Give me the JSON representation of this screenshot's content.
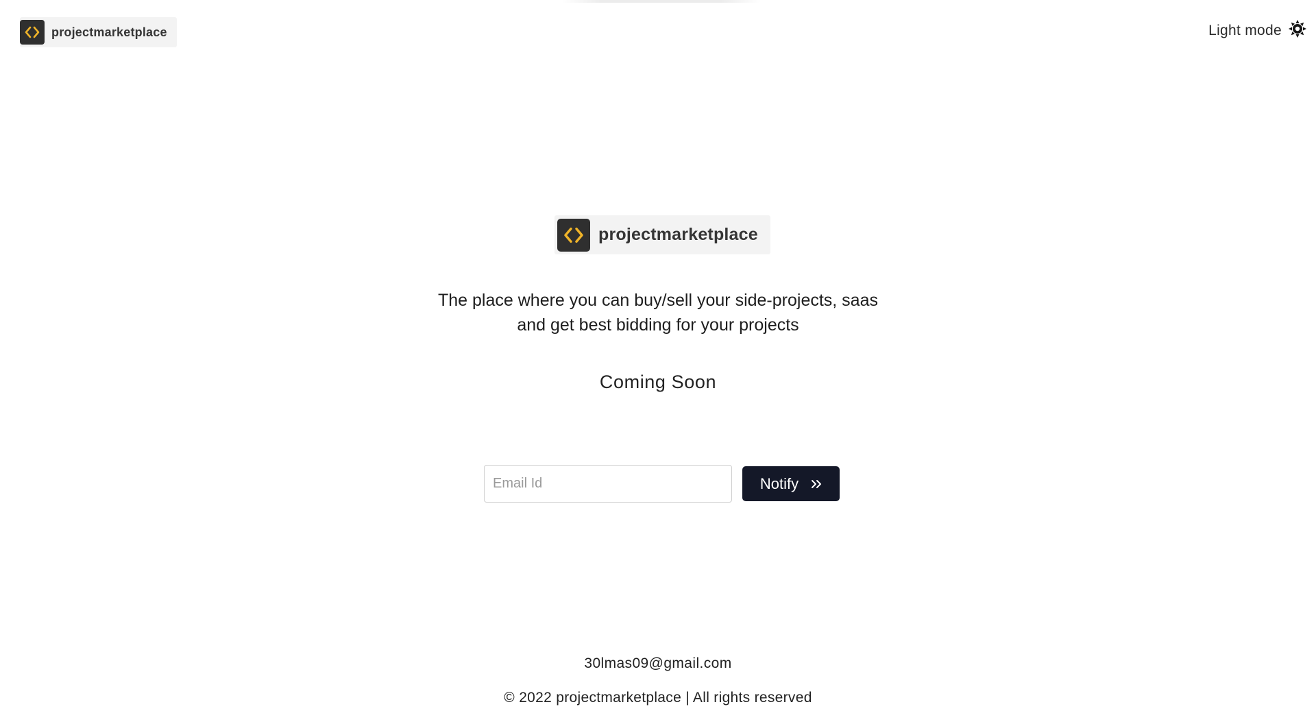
{
  "header": {
    "brand": "projectmarketplace",
    "logo_icon": "code-brackets-icon",
    "theme_label": "Light mode",
    "theme_icon": "sun-icon"
  },
  "hero": {
    "brand": "projectmarketplace",
    "tagline_line1": "The place where you can buy/sell your side-projects, saas",
    "tagline_line2": "and get best bidding for your projects",
    "status": "Coming Soon"
  },
  "notify_form": {
    "email_placeholder": "Email Id",
    "email_value": "",
    "button_label": "Notify",
    "button_icon": "double-chevron-right-icon"
  },
  "footer": {
    "email": "30lmas09@gmail.com",
    "copyright": "© 2022 projectmarketplace | All rights reserved"
  },
  "colors": {
    "logo_bg": "#2f2f2f",
    "logo_accent": "#f0b429",
    "button_bg": "#141828",
    "text": "#1e1e1e"
  }
}
